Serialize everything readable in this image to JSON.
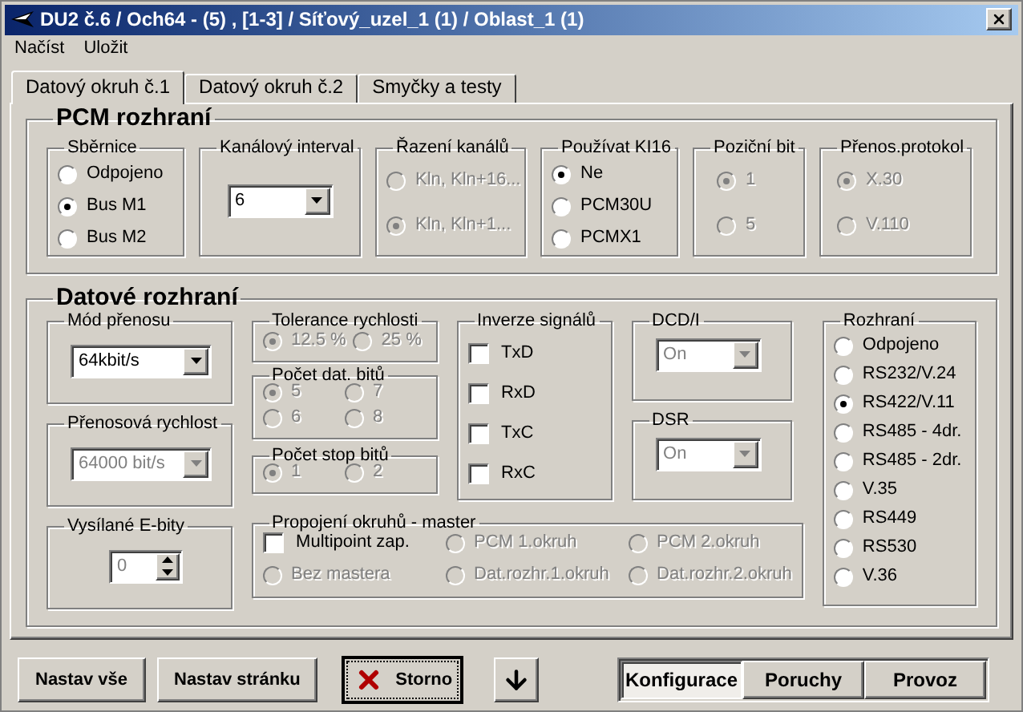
{
  "window": {
    "title": "DU2 č.6 / Och64 - (5) , [1-3] / Síťový_uzel_1 (1) / Oblast_1 (1)"
  },
  "menu": [
    {
      "label": "Načíst"
    },
    {
      "label": "Uložit"
    }
  ],
  "tabs": [
    {
      "label": "Datový okruh č.1",
      "selected": true
    },
    {
      "label": "Datový okruh č.2",
      "selected": false
    },
    {
      "label": "Smyčky a testy",
      "selected": false
    }
  ],
  "pcm": {
    "title": "PCM rozhraní",
    "sbernice": {
      "title": "Sběrnice",
      "disabled": false,
      "options": [
        {
          "label": "Odpojeno",
          "selected": false
        },
        {
          "label": "Bus M1",
          "selected": true
        },
        {
          "label": "Bus M2",
          "selected": false
        }
      ]
    },
    "kanalovy_interval": {
      "title": "Kanálový interval",
      "disabled": false,
      "value": "6"
    },
    "razeni_kanalu": {
      "title": "Řazení kanálů",
      "disabled": true,
      "options": [
        {
          "label": "Kln, Kln+16...",
          "selected": false
        },
        {
          "label": "Kln, Kln+1...",
          "selected": true
        }
      ]
    },
    "pouzivat_ki16": {
      "title": "Používat KI16",
      "disabled": false,
      "options": [
        {
          "label": "Ne",
          "selected": true
        },
        {
          "label": "PCM30U",
          "selected": false
        },
        {
          "label": "PCMX1",
          "selected": false
        }
      ]
    },
    "pozicni_bit": {
      "title": "Poziční bit",
      "disabled": true,
      "options": [
        {
          "label": "1",
          "selected": true
        },
        {
          "label": "5",
          "selected": false
        }
      ]
    },
    "prenos_protokol": {
      "title": "Přenos.protokol",
      "disabled": true,
      "options": [
        {
          "label": "X.30",
          "selected": true
        },
        {
          "label": "V.110",
          "selected": false
        }
      ]
    }
  },
  "datove": {
    "title": "Datové rozhraní",
    "mod_prenosu": {
      "title": "Mód přenosu",
      "disabled": false,
      "value": "64kbit/s"
    },
    "prenosova_rychlost": {
      "title": "Přenosová rychlost",
      "disabled": true,
      "value": "64000 bit/s"
    },
    "e_bity": {
      "title": "Vysílané E-bity",
      "disabled": true,
      "value": "0"
    },
    "tolerance": {
      "title": "Tolerance rychlosti",
      "disabled": true,
      "options": [
        {
          "label": "12.5 %",
          "selected": true
        },
        {
          "label": "25 %",
          "selected": false
        }
      ]
    },
    "datove_bity": {
      "title": "Počet dat. bitů",
      "disabled": true,
      "options": [
        {
          "label": "5",
          "selected": true
        },
        {
          "label": "7",
          "selected": false
        },
        {
          "label": "6",
          "selected": false
        },
        {
          "label": "8",
          "selected": false
        }
      ]
    },
    "stop_bity": {
      "title": "Počet stop bitů",
      "disabled": true,
      "options": [
        {
          "label": "1",
          "selected": true
        },
        {
          "label": "2",
          "selected": false
        }
      ]
    },
    "inverze": {
      "title": "Inverze signálů",
      "disabled": false,
      "items": [
        {
          "label": "TxD",
          "checked": false
        },
        {
          "label": "RxD",
          "checked": false
        },
        {
          "label": "TxC",
          "checked": false
        },
        {
          "label": "RxC",
          "checked": false
        }
      ]
    },
    "dcd": {
      "title": "DCD/I",
      "disabled": true,
      "value": "On"
    },
    "dsr": {
      "title": "DSR",
      "disabled": true,
      "value": "On"
    },
    "propojeni": {
      "title": "Propojení okruhů  - master",
      "items": [
        {
          "kind": "checkbox",
          "label": "Multipoint zap.",
          "checked": false,
          "disabled": false
        },
        {
          "kind": "radio",
          "label": "PCM 1.okruh",
          "selected": false,
          "disabled": true
        },
        {
          "kind": "radio",
          "label": "PCM 2.okruh",
          "selected": false,
          "disabled": true
        },
        {
          "kind": "radio",
          "label": "Bez mastera",
          "selected": false,
          "disabled": true
        },
        {
          "kind": "radio",
          "label": "Dat.rozhr.1.okruh",
          "selected": false,
          "disabled": true
        },
        {
          "kind": "radio",
          "label": "Dat.rozhr.2.okruh",
          "selected": false,
          "disabled": true
        }
      ]
    },
    "rozhrani": {
      "title": "Rozhraní",
      "disabled": false,
      "options": [
        {
          "label": "Odpojeno",
          "selected": false
        },
        {
          "label": "RS232/V.24",
          "selected": false
        },
        {
          "label": "RS422/V.11",
          "selected": true
        },
        {
          "label": "RS485 - 4dr.",
          "selected": false
        },
        {
          "label": "RS485 - 2dr.",
          "selected": false
        },
        {
          "label": "V.35",
          "selected": false
        },
        {
          "label": "RS449",
          "selected": false
        },
        {
          "label": "RS530",
          "selected": false
        },
        {
          "label": "V.36",
          "selected": false
        }
      ]
    }
  },
  "buttons": [
    {
      "kind": "text",
      "label": "Nastav vše"
    },
    {
      "kind": "text",
      "label": "Nastav stránku"
    },
    {
      "kind": "cancel",
      "label": "Storno"
    },
    {
      "kind": "down"
    }
  ],
  "modes": [
    {
      "label": "Konfigurace",
      "selected": true
    },
    {
      "label": "Poruchy",
      "selected": false
    },
    {
      "label": "Provoz",
      "selected": false
    }
  ]
}
